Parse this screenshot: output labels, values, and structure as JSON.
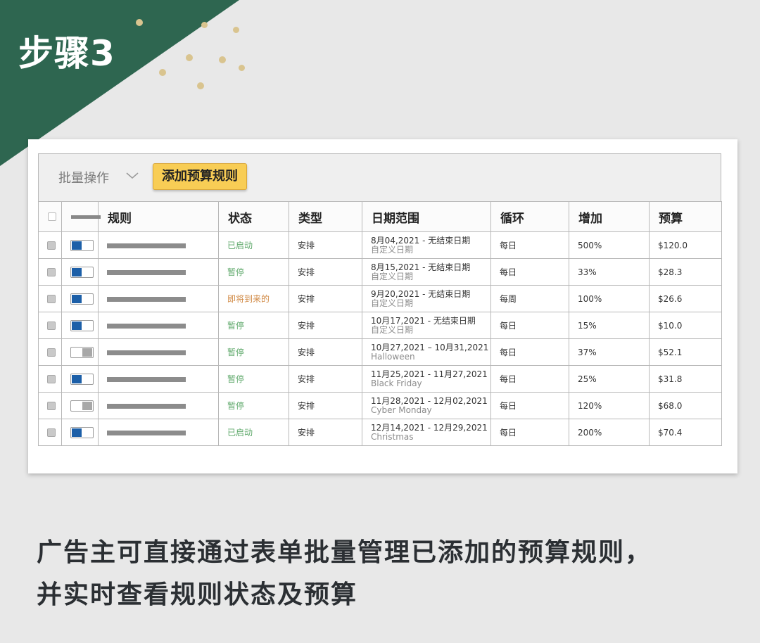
{
  "header": {
    "step_label": "步骤3"
  },
  "toolbar": {
    "bulk_label": "批量操作",
    "add_button_label": "添加预算规则"
  },
  "table": {
    "columns": [
      "规则",
      "状态",
      "类型",
      "日期范围",
      "循环",
      "增加",
      "预算"
    ],
    "rows": [
      {
        "enabled": true,
        "status": "已启动",
        "status_color": "#5ea86a",
        "type": "安排",
        "date": "8月04,2021 - 无结束日期",
        "date_sub": "自定义日期",
        "cycle": "每日",
        "increase": "500%",
        "budget": "$120.0"
      },
      {
        "enabled": true,
        "status": "暂停",
        "status_color": "#5ea86a",
        "type": "安排",
        "date": "8月15,2021 - 无结束日期",
        "date_sub": "自定义日期",
        "cycle": "每日",
        "increase": "33%",
        "budget": "$28.3"
      },
      {
        "enabled": true,
        "status": "即将到来的",
        "status_color": "#d18a45",
        "type": "安排",
        "date": "9月20,2021 - 无结束日期",
        "date_sub": "自定义日期",
        "cycle": "每周",
        "increase": "100%",
        "budget": "$26.6"
      },
      {
        "enabled": true,
        "status": "暂停",
        "status_color": "#5ea86a",
        "type": "安排",
        "date": "10月17,2021 - 无结束日期",
        "date_sub": "自定义日期",
        "cycle": "每日",
        "increase": "15%",
        "budget": "$10.0"
      },
      {
        "enabled": false,
        "status": "暂停",
        "status_color": "#5ea86a",
        "type": "安排",
        "date": "10月27,2021 – 10月31,2021",
        "date_sub": "Halloween",
        "cycle": "每日",
        "increase": "37%",
        "budget": "$52.1"
      },
      {
        "enabled": true,
        "status": "暂停",
        "status_color": "#5ea86a",
        "type": "安排",
        "date": "11月25,2021 - 11月27,2021",
        "date_sub": "Black Friday",
        "cycle": "每日",
        "increase": "25%",
        "budget": "$31.8"
      },
      {
        "enabled": false,
        "status": "暂停",
        "status_color": "#5ea86a",
        "type": "安排",
        "date": "11月28,2021 - 12月02,2021",
        "date_sub": "Cyber Monday",
        "cycle": "每日",
        "increase": "120%",
        "budget": "$68.0"
      },
      {
        "enabled": true,
        "status": "已启动",
        "status_color": "#5ea86a",
        "type": "安排",
        "date": "12月14,2021 - 12月29,2021",
        "date_sub": "Christmas",
        "cycle": "每日",
        "increase": "200%",
        "budget": "$70.4"
      }
    ]
  },
  "caption": {
    "line1": "广告主可直接通过表单批量管理已添加的预算规则，",
    "line2": "并实时查看规则状态及预算"
  },
  "colors": {
    "corner": "#2e6650",
    "button": "#f8cd55",
    "toggle_on": "#1c5fa8",
    "status_green": "#5ea86a",
    "status_orange": "#d18a45"
  }
}
